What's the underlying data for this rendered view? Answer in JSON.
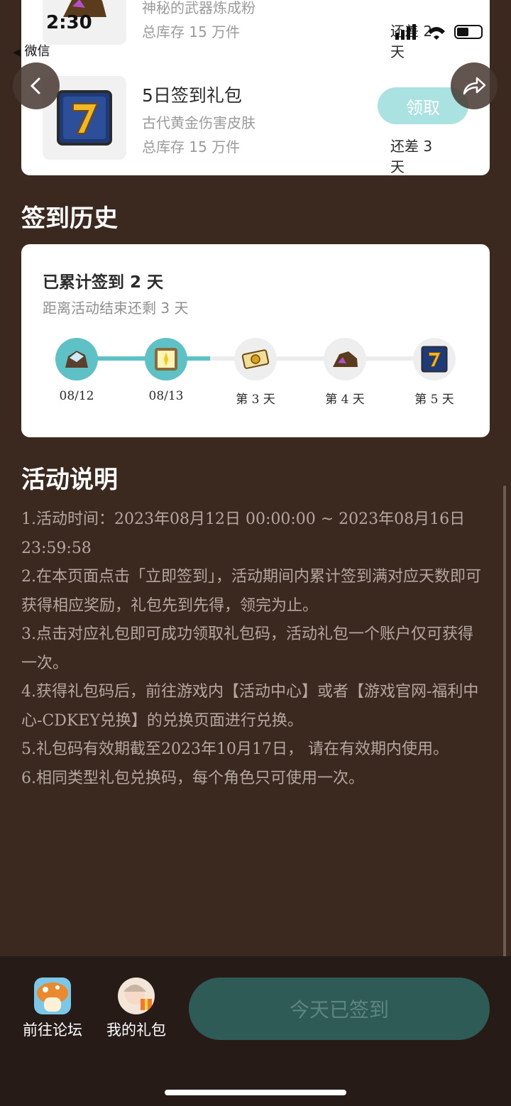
{
  "status_bar": {
    "time": "2:30",
    "back_app": "微信"
  },
  "rewards": [
    {
      "desc": "神秘的武器炼成粉",
      "stock": "总库存 15 万件",
      "remaining": "还差 2 天",
      "icon": "ore-icon"
    },
    {
      "name": "5日签到礼包",
      "desc": "古代黄金伤害皮肤",
      "stock": "总库存 15 万件",
      "button": "领取",
      "remaining": "还差 3 天",
      "icon": "lucky-seven-icon"
    }
  ],
  "history": {
    "title": "签到历史",
    "cumulative": "已累计签到 2 天",
    "days_left": "距离活动结束还剩 3 天",
    "progress_fraction": 0.4,
    "days": [
      {
        "label": "08/12",
        "done": true,
        "icon": "crystal-rock-icon"
      },
      {
        "label": "08/13",
        "done": true,
        "icon": "glowing-chest-icon"
      },
      {
        "label": "第 3 天",
        "done": false,
        "icon": "coin-ticket-icon"
      },
      {
        "label": "第 4 天",
        "done": false,
        "icon": "ore-icon"
      },
      {
        "label": "第 5 天",
        "done": false,
        "icon": "lucky-seven-icon"
      }
    ]
  },
  "activity": {
    "title": "活动说明",
    "rules": [
      "1.活动时间：2023年08月12日 00:00:00 ~ 2023年08月16日 23:59:58",
      "2.在本页面点击「立即签到」，活动期间内累计签到满对应天数即可获得相应奖励，礼包先到先得，领完为止。",
      "3.点击对应礼包即可成功领取礼包码，活动礼包一个账户仅可获得一次。",
      "4.获得礼包码后，前往游戏内【活动中心】或者【游戏官网-福利中心-CDKEY兑换】的兑换页面进行兑换。",
      "5.礼包码有效期截至2023年10月17日， 请在有效期内使用。",
      "6.相同类型礼包兑换码，每个角色只可使用一次。"
    ]
  },
  "bottom": {
    "forum": "前往论坛",
    "gifts": "我的礼包",
    "signed": "今天已签到"
  },
  "colors": {
    "background": "#3b2920",
    "accent": "#5ec1c5",
    "button_light": "#a9e2e0",
    "bottom_bar": "#261b17"
  }
}
